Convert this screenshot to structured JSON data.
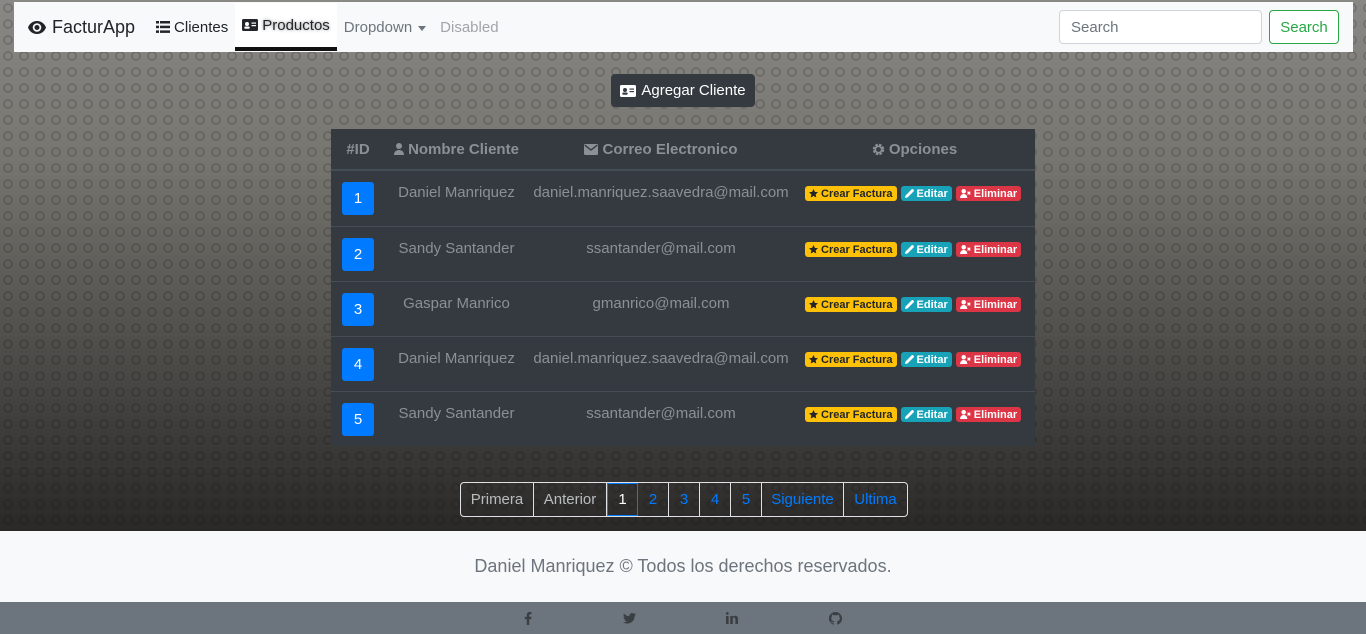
{
  "navbar": {
    "brand": "FacturApp",
    "items": [
      {
        "label": "Clientes"
      },
      {
        "label": "Productos"
      },
      {
        "label": "Dropdown"
      },
      {
        "label": "Disabled"
      }
    ],
    "search_placeholder": "Search",
    "search_button": "Search"
  },
  "main": {
    "add_button": "Agregar Cliente",
    "table": {
      "headers": [
        "#ID",
        "Nombre Cliente",
        "Correo Electronico",
        "Opciones"
      ],
      "rows": [
        {
          "id": "1",
          "name": "Daniel Manriquez",
          "email": "daniel.manriquez.saavedra@mail.com"
        },
        {
          "id": "2",
          "name": "Sandy Santander",
          "email": "ssantander@mail.com"
        },
        {
          "id": "3",
          "name": "Gaspar Manrico",
          "email": "gmanrico@mail.com"
        },
        {
          "id": "4",
          "name": "Daniel Manriquez",
          "email": "daniel.manriquez.saavedra@mail.com"
        },
        {
          "id": "5",
          "name": "Sandy Santander",
          "email": "ssantander@mail.com"
        }
      ],
      "actions": {
        "invoice": "Crear Factura",
        "edit": "Editar",
        "delete": "Eliminar"
      }
    },
    "pagination": [
      "Primera",
      "Anterior",
      "1",
      "2",
      "3",
      "4",
      "5",
      "Siguiente",
      "Ultima"
    ]
  },
  "footer": {
    "text": "Daniel Manriquez © Todos los derechos reservados.",
    "social": [
      "facebook-icon",
      "twitter-icon",
      "linkedin-icon",
      "github-icon"
    ]
  },
  "colors": {
    "primary": "#007bff",
    "success": "#28a745",
    "warning": "#ffc107",
    "info": "#17a2b8",
    "danger": "#dc3545",
    "dark": "#343a40"
  }
}
